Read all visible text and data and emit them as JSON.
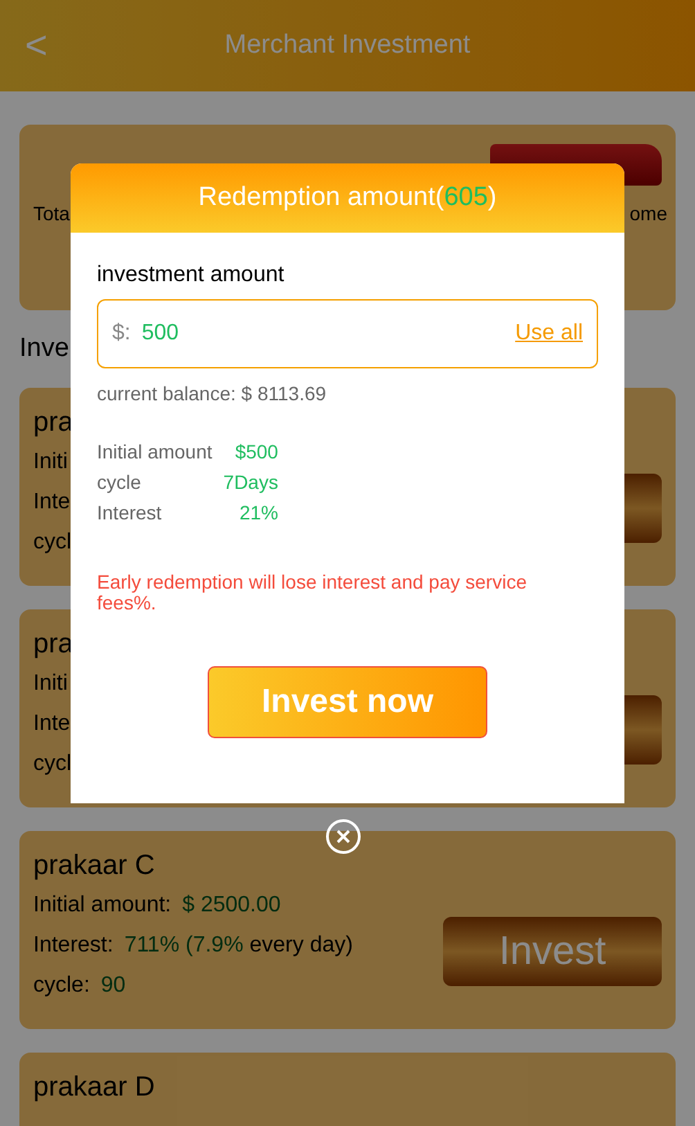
{
  "header": {
    "back": "<",
    "title": "Merchant Investment"
  },
  "summary": {
    "total_label": "Tota",
    "income_label": "ome"
  },
  "section_title": "Inve",
  "products": [
    {
      "name": "pra",
      "rows": [
        {
          "label": "Initi"
        },
        {
          "label": "Inte"
        },
        {
          "label": "cycl"
        }
      ]
    },
    {
      "name": "pra",
      "rows": [
        {
          "label": "Initi"
        },
        {
          "label": "Inte"
        },
        {
          "label": "cycl"
        }
      ]
    },
    {
      "name": "prakaar C",
      "rows": [
        {
          "label": "Initial amount:",
          "value": "$ 2500.00"
        },
        {
          "label": "Interest:",
          "value": "711% (7.9%",
          "suffix": "every day)"
        },
        {
          "label": "cycle:",
          "value": "90"
        }
      ],
      "button": "Invest"
    },
    {
      "name": "prakaar D"
    }
  ],
  "modal": {
    "title": "Redemption amount(",
    "amount": "605",
    "title_end": ")",
    "amount_label": "investment amount",
    "currency": "$:",
    "value": "500",
    "use_all": "Use all",
    "balance": "current balance: $ 8113.69",
    "details": [
      {
        "label": "Initial amount",
        "value": "$500"
      },
      {
        "label": "cycle",
        "value": "7Days"
      },
      {
        "label": "Interest",
        "value": "21%"
      }
    ],
    "warning": "Early redemption will lose interest and pay service fees%.",
    "submit": "Invest now"
  }
}
